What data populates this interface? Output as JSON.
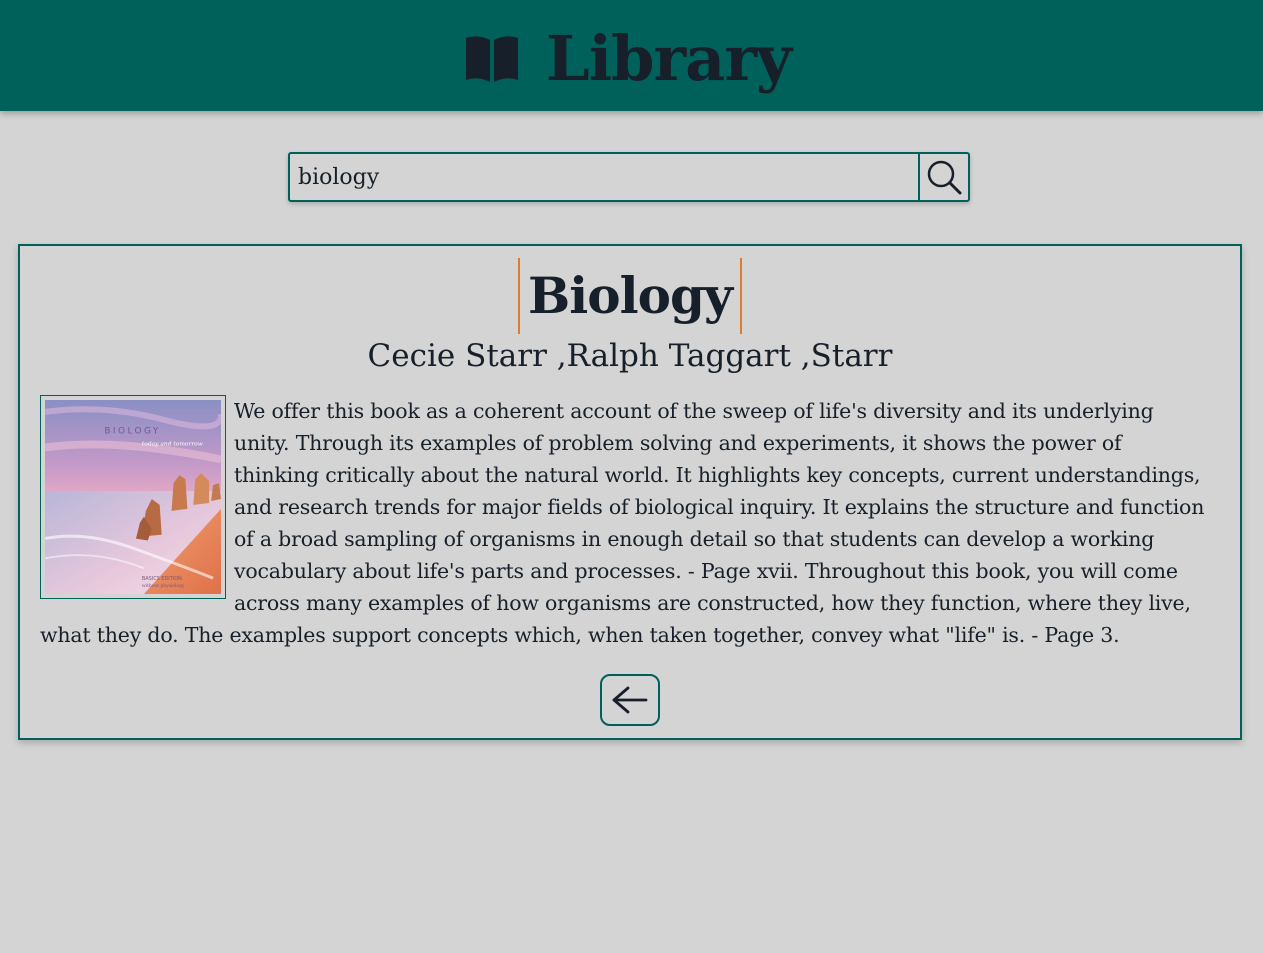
{
  "header": {
    "title": "Library",
    "icon": "open-book-icon"
  },
  "search": {
    "value": "biology",
    "button_icon": "search-icon"
  },
  "book": {
    "title": "Biology",
    "authors": "Cecie Starr ,Ralph Taggart ,Starr",
    "cover": {
      "title_text": "BIOLOGY",
      "subtitle_text": "today and tomorrow",
      "edition_text": "BASICS EDITION",
      "edition_subtext": "without physiology"
    },
    "description": "We offer this book as a coherent account of the sweep of life's diversity and its underlying unity. Through its examples of problem solving and experiments, it shows the power of thinking critically about the natural world. It highlights key concepts, current understandings, and research trends for major fields of biological inquiry. It explains the structure and function of a broad sampling of organisms in enough detail so that students can develop a working vocabulary about life's parts and processes. - Page xvii. Throughout this book, you will come across many examples of how organisms are constructed, how they function, where they live, what they do. The examples support concepts which, when taken together, convey what \"life\" is. - Page 3."
  },
  "back_button": {
    "icon": "arrow-left-icon"
  },
  "colors": {
    "header_bg": "#00605a",
    "page_bg": "#d4d4d4",
    "text": "#17202a",
    "title_accent": "#e07a2f"
  }
}
